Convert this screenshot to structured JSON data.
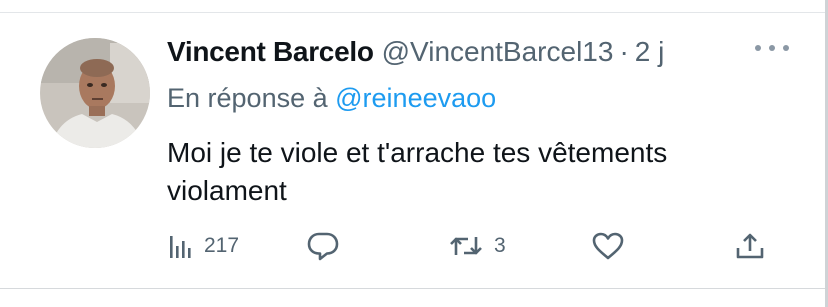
{
  "tweet": {
    "display_name": "Vincent Barcelo",
    "handle": "@VincentBarcel13",
    "separator": "·",
    "time": "2 j",
    "reply_prefix": "En réponse à",
    "reply_mention": "@reineevaoo",
    "text_line1": "Moi je te viole et t'arrache tes vêtements",
    "text_line2": "violament"
  },
  "actions": {
    "views_icon": "analytics-icon",
    "views_count": "217",
    "reply_icon": "reply-icon",
    "retweet_icon": "retweet-icon",
    "retweet_count": "3",
    "like_icon": "heart-icon",
    "share_icon": "share-icon",
    "more_icon": "more-icon"
  },
  "colors": {
    "text": "#0f1419",
    "muted": "#536471",
    "link": "#1d9bf0"
  }
}
